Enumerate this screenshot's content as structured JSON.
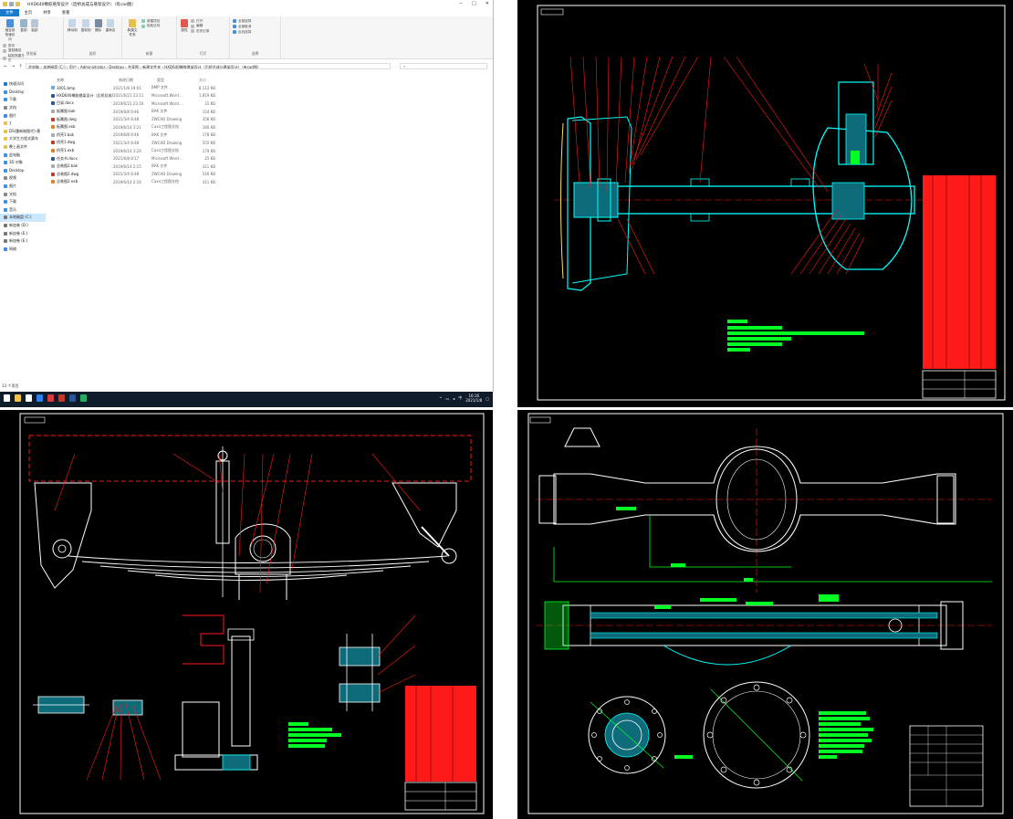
{
  "explorer": {
    "title": "HXD640橡胶悬架设计（后桥总成与悬架设计）（有cad图）",
    "window_controls": {
      "minimize": "−",
      "maximize": "□",
      "close": "✕"
    },
    "ribbon_tabs": [
      "文件",
      "主页",
      "共享",
      "查看"
    ],
    "ribbon": {
      "clipboard": {
        "label": "剪贴板",
        "pin": "固定到快速访问",
        "copy": "复制",
        "paste": "粘贴",
        "copy_path": "复制路径",
        "paste_shortcut": "粘贴快捷方式",
        "cut": "剪切"
      },
      "organize": {
        "label": "组织",
        "move_to": "移动到",
        "copy_to": "复制到",
        "delete": "删除",
        "rename": "重命名"
      },
      "new": {
        "label": "新建",
        "new_folder": "新建文件夹",
        "new_item": "新建项目",
        "easy_access": "轻松访问"
      },
      "open": {
        "label": "打开",
        "properties": "属性",
        "open": "打开",
        "edit": "编辑",
        "history": "历史记录"
      },
      "select": {
        "label": "选择",
        "select_all": "全部选择",
        "select_none": "全部取消",
        "invert": "反向选择"
      }
    },
    "nav_buttons": {
      "back": "←",
      "forward": "→",
      "up": "↑"
    },
    "address": "此电脑 › 本地磁盘 (C:) › 用户 › Administrator › Desktop › 共享图 › 新建文件夹 › HXD640橡胶悬架设计（后桥总成与悬架设计）（有cad图）",
    "search_placeholder": "",
    "navpane": [
      {
        "label": "快速访问",
        "icon": "star-icon",
        "color": "#1979ca"
      },
      {
        "label": "Desktop",
        "icon": "desktop-icon",
        "color": "#3a8ee6"
      },
      {
        "label": "下载",
        "icon": "download-icon",
        "color": "#3a8ee6"
      },
      {
        "label": "文档",
        "icon": "document-icon",
        "color": "#888888"
      },
      {
        "label": "图片",
        "icon": "picture-icon",
        "color": "#3a8ee6"
      },
      {
        "label": "7",
        "icon": "folder-icon",
        "color": "#e8c14a"
      },
      {
        "label": "DS(重新制图代)-黄",
        "icon": "folder-icon",
        "color": "#e8c14a"
      },
      {
        "label": "大学生方程式赛车",
        "icon": "folder-icon",
        "color": "#e8c14a"
      },
      {
        "label": "晚上画文件",
        "icon": "folder-icon",
        "color": "#e8c14a"
      },
      {
        "label": "此电脑",
        "icon": "computer-icon",
        "color": "#3a8ee6"
      },
      {
        "label": "3D 对象",
        "icon": "cube-icon",
        "color": "#3a8ee6"
      },
      {
        "label": "Desktop",
        "icon": "desktop-icon",
        "color": "#3a8ee6"
      },
      {
        "label": "视频",
        "icon": "video-icon",
        "color": "#888888"
      },
      {
        "label": "图片",
        "icon": "picture-icon",
        "color": "#3a8ee6"
      },
      {
        "label": "文档",
        "icon": "document-icon",
        "color": "#888888"
      },
      {
        "label": "下载",
        "icon": "download-icon",
        "color": "#3a8ee6"
      },
      {
        "label": "音乐",
        "icon": "music-icon",
        "color": "#3a8ee6"
      },
      {
        "label": "本地磁盘 (C:)",
        "icon": "drive-icon",
        "color": "#777777",
        "selected": true
      },
      {
        "label": "新加卷 (D:)",
        "icon": "drive-icon",
        "color": "#777777"
      },
      {
        "label": "新加卷 (E:)",
        "icon": "drive-icon",
        "color": "#777777"
      },
      {
        "label": "新加卷 (E:)",
        "icon": "drive-icon",
        "color": "#777777"
      },
      {
        "label": "网络",
        "icon": "network-icon",
        "color": "#3a8ee6"
      }
    ],
    "columns": [
      "名称",
      "修改日期",
      "类型",
      "大小"
    ],
    "files": [
      {
        "name": "3001.bmp",
        "date": "2021/1/8 19:01",
        "type": "BMP 文件",
        "size": "8,112 KB",
        "color": "#6fa8dc"
      },
      {
        "name": "HXD640橡胶悬架设计（后桥总成与悬...",
        "date": "2021/6/21 23:11",
        "type": "Microsoft Word ...",
        "size": "1,819 KB",
        "color": "#2b5797"
      },
      {
        "name": "目录.docx",
        "date": "2019/6/21 23:10",
        "type": "Microsoft Word ...",
        "size": "31 KB",
        "color": "#2b5797"
      },
      {
        "name": "板簧图.bak",
        "date": "2019/6/8 9:46",
        "type": "BAK 文件",
        "size": "154 KB",
        "color": "#aaaaaa"
      },
      {
        "name": "板簧图.dwg",
        "date": "2021/3/4 8:48",
        "type": "ZWCAD Drawing",
        "size": "356 KB",
        "color": "#c0392b"
      },
      {
        "name": "板簧图.exb",
        "date": "2019/6/14 3:21",
        "type": "Caxa工程图文档",
        "size": "180 KB",
        "color": "#e67e22"
      },
      {
        "name": "桥壳1.bak",
        "date": "2019/6/8 9:46",
        "type": "BAK 文件",
        "size": "178 KB",
        "color": "#aaaaaa"
      },
      {
        "name": "桥壳1.dwg",
        "date": "2021/3/4 8:48",
        "type": "ZWCAD Drawing",
        "size": "555 KB",
        "color": "#c0392b"
      },
      {
        "name": "桥壳1.exb",
        "date": "2019/6/14 3:24",
        "type": "Caxa工程图文档",
        "size": "179 KB",
        "color": "#e67e22"
      },
      {
        "name": "任务书.docx",
        "date": "2021/6/8 8:17",
        "type": "Microsoft Word ...",
        "size": "25 KB",
        "color": "#2b5797"
      },
      {
        "name": "总装图2.bak",
        "date": "2019/6/14 2:15",
        "type": "BAK 文件",
        "size": "311 KB",
        "color": "#aaaaaa"
      },
      {
        "name": "总装图2.dwg",
        "date": "2021/3/4 8:48",
        "type": "ZWCAD Drawing",
        "size": "516 KB",
        "color": "#c0392b"
      },
      {
        "name": "总装图2.exb",
        "date": "2019/6/14 2:16",
        "type": "Caxa工程图文档",
        "size": "311 KB",
        "color": "#e67e22"
      }
    ],
    "status": "13 个项目"
  },
  "taskbar": {
    "apps": [
      {
        "icon": "windows-start-icon",
        "color": "#ffffff"
      },
      {
        "icon": "explorer-icon",
        "color": "#f2c14e"
      },
      {
        "icon": "search-icon",
        "color": "#ffffff"
      },
      {
        "icon": "browser-icon",
        "color": "#2f80ed"
      },
      {
        "icon": "caxa-icon",
        "color": "#d83b3b"
      },
      {
        "icon": "zwcad-icon",
        "color": "#c0392b"
      },
      {
        "icon": "word-icon",
        "color": "#2b5797"
      },
      {
        "icon": "green-app-icon",
        "color": "#27ae60"
      }
    ],
    "time": "16:16",
    "date": "2021/1/8"
  },
  "colors": {
    "cad_bg": "#000000",
    "cad_red": "#ff1a1a",
    "cad_cyan": "#00ffff",
    "cad_green": "#00ff22",
    "cad_white": "#ffffff",
    "cad_yellow": "#ffe066"
  }
}
